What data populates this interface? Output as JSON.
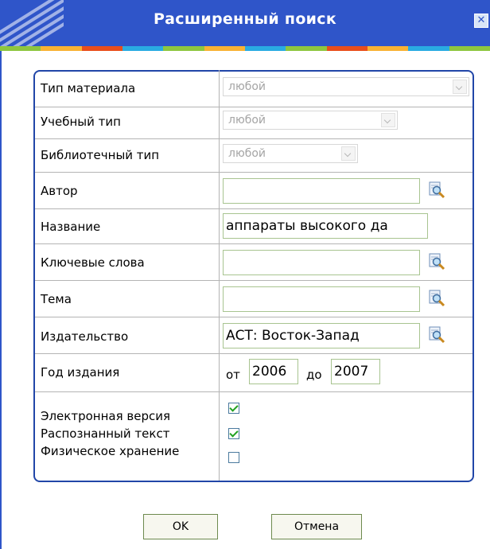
{
  "window": {
    "title": "Расширенный поиск",
    "close_glyph": "✕",
    "title_bg_color": "#2f55c9",
    "stripe_colors": [
      "#8ec63f",
      "#f9b233",
      "#e94e1b",
      "#29abe2",
      "#8ec63f",
      "#f9b233",
      "#29abe2",
      "#8ec63f",
      "#e94e1b",
      "#f9b233",
      "#29abe2",
      "#8ec63f"
    ]
  },
  "form": {
    "material_type": {
      "label": "Тип материала",
      "value": "любой"
    },
    "study_type": {
      "label": "Учебный тип",
      "value": "любой"
    },
    "library_type": {
      "label": "Библиотечный тип",
      "value": "любой"
    },
    "author": {
      "label": "Автор",
      "value": ""
    },
    "title": {
      "label": "Название",
      "value": "аппараты высокого да"
    },
    "keywords": {
      "label": "Ключевые слова",
      "value": ""
    },
    "subject": {
      "label": "Тема",
      "value": ""
    },
    "publisher": {
      "label": "Издательство",
      "value": "АСТ: Восток-Запад"
    },
    "year": {
      "label": "Год издания",
      "from_label": "от",
      "from": "2006",
      "to_label": "до",
      "to": "2007"
    },
    "options": [
      {
        "label": "Электронная версия",
        "checked": true
      },
      {
        "label": "Распознанный текст",
        "checked": true
      },
      {
        "label": "Физическое хранение",
        "checked": false
      }
    ]
  },
  "buttons": {
    "ok": "OK",
    "cancel": "Отмена"
  },
  "icons": {
    "search": "lookup-magnifier-icon"
  }
}
